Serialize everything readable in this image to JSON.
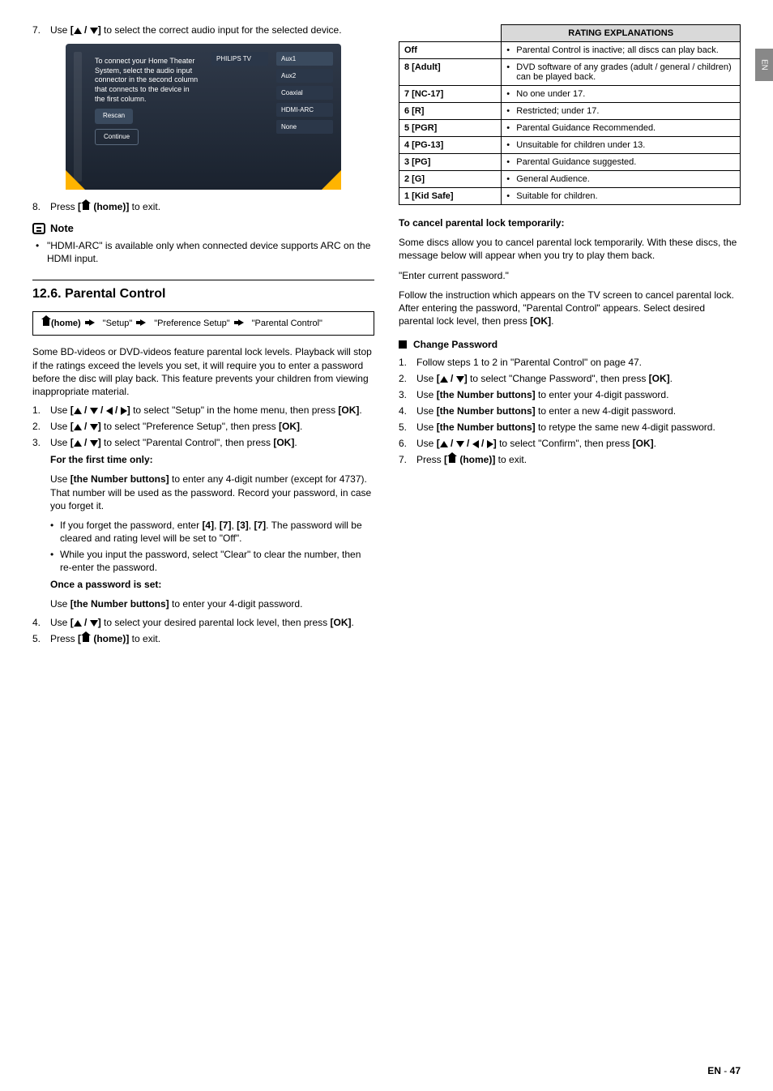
{
  "sideTab": "EN",
  "left": {
    "step7": {
      "num": "7.",
      "text_before": "Use ",
      "bracket": "[",
      "sep": " / ",
      "end_bracket": "]",
      "text_after": " to select the correct audio input for the selected device."
    },
    "screenshot": {
      "instructions": "To connect your Home Theater System, select the audio input connector in the second column that connects to the device in the first column.",
      "middle_header": "PHILIPS TV",
      "options": [
        "Aux1",
        "Aux2",
        "Coaxial",
        "HDMI-ARC",
        "None"
      ],
      "btn_rescan": "Rescan",
      "btn_continue": "Continue"
    },
    "step8": {
      "num": "8.",
      "text_before": "Press ",
      "bracket_label": " (home)]",
      "text_after": " to exit."
    },
    "note_label": "Note",
    "note_item": "\"HDMI-ARC\" is available only when connected device supports ARC on the HDMI input.",
    "section_title": "12.6.  Parental Control",
    "nav": {
      "home": " (home)",
      "setup": "\"Setup\"",
      "pref": "\"Preference Setup\"",
      "parental": "\"Parental Control\""
    },
    "intro": "Some BD-videos or DVD-videos feature parental lock levels. Playback will stop if the ratings exceed the levels you set, it will require you to enter a password before the disc will play back. This feature prevents your children from viewing inappropriate material.",
    "s1": {
      "num": "1.",
      "a": "Use ",
      "b": " to select \"Setup\" in the home menu, then press ",
      "ok": "[OK]",
      "c": "."
    },
    "s2": {
      "num": "2.",
      "a": "Use ",
      "b": " to select \"Preference Setup\", then press ",
      "ok": "[OK]",
      "c": "."
    },
    "s3": {
      "num": "3.",
      "a": "Use ",
      "b": " to select \"Parental Control\", then press ",
      "ok": "[OK]",
      "c": "."
    },
    "first_time_label": "For the first time only:",
    "first_time_body_a": "Use ",
    "first_time_body_btn": "[the Number buttons]",
    "first_time_body_b": " to enter any 4-digit number (except for 4737). That number will be used as the password. Record your password, in case you forget it.",
    "sub1_a": "If you forget the password, enter ",
    "sub1_codes": [
      "[4]",
      "[7]",
      "[3]",
      "[7]"
    ],
    "sub1_b": ". The password will be cleared and rating level will be set to \"Off\".",
    "sub2": "While you input the password, select \"Clear\" to clear the number, then re-enter the password.",
    "once_set_label": "Once a password is set:",
    "once_set_a": "Use ",
    "once_set_btn": "[the Number buttons]",
    "once_set_b": " to enter your 4-digit password.",
    "s4": {
      "num": "4.",
      "a": "Use ",
      "b": " to select your desired parental lock level, then press ",
      "ok": "[OK]",
      "c": "."
    },
    "s5": {
      "num": "5.",
      "a": "Press ",
      "label": " (home)]",
      "b": " to exit."
    }
  },
  "right": {
    "table_header": "RATING EXPLANATIONS",
    "rows": [
      {
        "k": "Off",
        "v": "Parental Control is inactive; all discs can play back."
      },
      {
        "k": "8 [Adult]",
        "v": "DVD software of any grades (adult / general / children) can be played back."
      },
      {
        "k": "7 [NC-17]",
        "v": "No one under 17."
      },
      {
        "k": "6 [R]",
        "v": "Restricted; under 17."
      },
      {
        "k": "5 [PGR]",
        "v": "Parental Guidance Recommended."
      },
      {
        "k": "4 [PG-13]",
        "v": "Unsuitable for children under 13."
      },
      {
        "k": "3 [PG]",
        "v": "Parental Guidance suggested."
      },
      {
        "k": "2 [G]",
        "v": "General Audience."
      },
      {
        "k": "1 [Kid Safe]",
        "v": "Suitable for children."
      }
    ],
    "cancel_heading": "To cancel parental lock temporarily:",
    "cancel_p1": "Some discs allow you to cancel parental lock temporarily. With these discs, the message below will appear when you try to play them back.",
    "cancel_p2": "\"Enter current password.\"",
    "cancel_p3_a": "Follow the instruction which appears on the TV screen to cancel parental lock. After entering the password, \"Parental Control\" appears. Select desired parental lock level, then press ",
    "cancel_p3_ok": "[OK]",
    "cancel_p3_b": ".",
    "change_heading": "Change Password",
    "c1": {
      "num": "1.",
      "t": "Follow steps 1 to 2 in \"Parental Control\" on page 47."
    },
    "c2": {
      "num": "2.",
      "a": "Use ",
      "b": " to select \"Change Password\", then press ",
      "ok": "[OK]",
      "c": "."
    },
    "c3": {
      "num": "3.",
      "a": "Use ",
      "btn": "[the Number buttons]",
      "b": " to enter your 4-digit password."
    },
    "c4": {
      "num": "4.",
      "a": "Use ",
      "btn": "[the Number buttons]",
      "b": " to enter a new 4-digit password."
    },
    "c5": {
      "num": "5.",
      "a": "Use ",
      "btn": "[the Number buttons]",
      "b": " to retype the same new 4-digit password."
    },
    "c6": {
      "num": "6.",
      "a": "Use ",
      "b": " to select \"Confirm\", then press ",
      "ok": "[OK]",
      "c": "."
    },
    "c7": {
      "num": "7.",
      "a": "Press ",
      "label": " (home)]",
      "b": " to exit."
    }
  },
  "footer": {
    "lang": "EN",
    "sep": " - ",
    "page": "47"
  }
}
